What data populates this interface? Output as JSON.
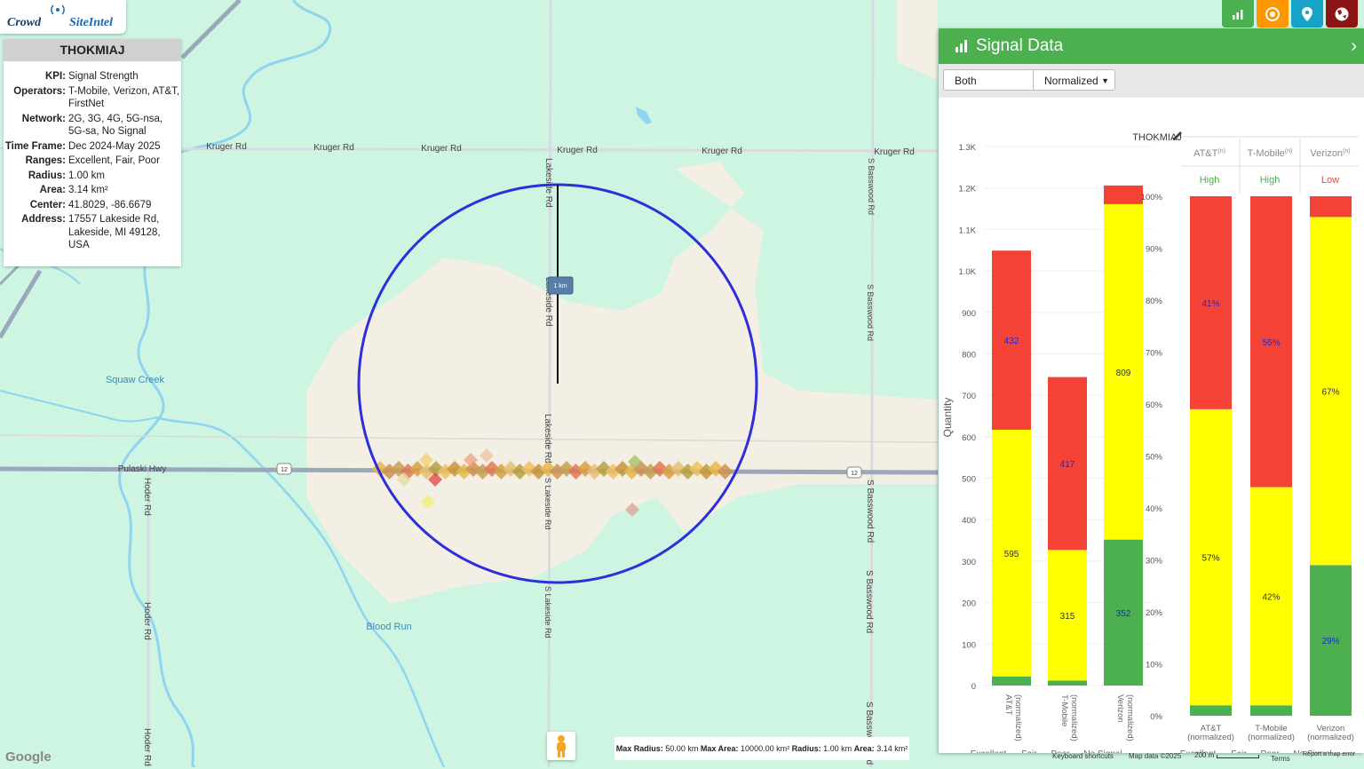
{
  "logo": {
    "part1": "Crowd",
    "part2": "SiteIntel"
  },
  "info": {
    "title": "THOKMIAJ",
    "rows": [
      {
        "k": "KPI:",
        "v": "Signal Strength"
      },
      {
        "k": "Operators:",
        "v": "T-Mobile, Verizon, AT&T, FirstNet"
      },
      {
        "k": "Network:",
        "v": "2G, 3G, 4G, 5G-nsa, 5G-sa, No Signal"
      },
      {
        "k": "Time Frame:",
        "v": "Dec 2024-May 2025"
      },
      {
        "k": "Ranges:",
        "v": "Excellent, Fair, Poor"
      },
      {
        "k": "Radius:",
        "v": "1.00 km"
      },
      {
        "k": "Area:",
        "v": "3.14 km²"
      },
      {
        "k": "Center:",
        "v": "41.8029, -86.6679"
      },
      {
        "k": "Address:",
        "v": "17557 Lakeside Rd, Lakeside, MI 49128, USA"
      }
    ]
  },
  "map": {
    "roads": {
      "kruger": "Kruger Rd",
      "lakeside": "Lakeside Rd",
      "s_lakeside": "S Lakeside Rd",
      "s_basswood": "S Basswood Rd",
      "pulaski": "Pulaski Hwy",
      "hoder": "Hoder Rd",
      "route": "12"
    },
    "water": {
      "squaw": "Squaw Creek",
      "blood": "Blood Run"
    },
    "scale_label": "1 km",
    "badge": {
      "max_radius_k": "Max Radius:",
      "max_radius_v": "50.00 km",
      "max_area_k": "Max Area:",
      "max_area_v": "10000.00 km²",
      "radius_k": "Radius:",
      "radius_v": "1.00 km",
      "area_k": "Area:",
      "area_v": "3.14 km²"
    },
    "footer": {
      "keyboard": "Keyboard shortcuts",
      "mapdata": "Map data ©2025",
      "scale": "200 m",
      "terms": "Terms",
      "report": "Report a map error"
    },
    "google": "Google"
  },
  "panel": {
    "title": "Signal Data",
    "select_mode": "Both",
    "select_norm": "Normalized",
    "chart_title": "THOKMIAJ",
    "colors": {
      "excellent": "#4caf50",
      "fair": "#ffff00",
      "poor": "#f44336",
      "nosignal": "#bdbdbd",
      "header": "#4caf50"
    },
    "legend": [
      "Excellent",
      "Fair",
      "Poor",
      "No Signal"
    ],
    "summary": [
      {
        "op": "AT&T",
        "sup": "(n)",
        "level": "High",
        "color": "#4caf50"
      },
      {
        "op": "T-Mobile",
        "sup": "(n)",
        "level": "High",
        "color": "#4caf50"
      },
      {
        "op": "Verizon",
        "sup": "(n)",
        "level": "Low",
        "color": "#f44336"
      }
    ]
  },
  "chart_data": [
    {
      "type": "bar",
      "stacked": true,
      "title": "THOKMIAJ",
      "ylabel": "Quantity",
      "ylim": [
        0,
        1300
      ],
      "yticks": [
        "0",
        "100",
        "200",
        "300",
        "400",
        "500",
        "600",
        "700",
        "800",
        "900",
        "1.0K",
        "1.1K",
        "1.2K",
        "1.3K"
      ],
      "categories": [
        "AT&T (normalized)",
        "T-Mobile (normalized)",
        "Verizon (normalized)"
      ],
      "series": [
        {
          "name": "Excellent",
          "values": [
            22,
            12,
            352
          ],
          "labels": [
            "",
            "",
            "352"
          ]
        },
        {
          "name": "Fair",
          "values": [
            595,
            315,
            809
          ],
          "labels": [
            "595",
            "315",
            "809"
          ]
        },
        {
          "name": "Poor",
          "values": [
            432,
            417,
            45
          ],
          "labels": [
            "432",
            "417",
            ""
          ]
        },
        {
          "name": "No Signal",
          "values": [
            0,
            0,
            0
          ],
          "labels": [
            "",
            "",
            ""
          ]
        }
      ]
    },
    {
      "type": "bar",
      "stacked": true,
      "ylim": [
        0,
        100
      ],
      "yticks": [
        "0%",
        "10%",
        "20%",
        "30%",
        "40%",
        "50%",
        "60%",
        "70%",
        "80%",
        "90%",
        "100%"
      ],
      "categories": [
        "AT&T (normalized)",
        "T-Mobile (normalized)",
        "Verizon (normalized)"
      ],
      "series": [
        {
          "name": "Excellent",
          "values": [
            2,
            2,
            29
          ],
          "labels": [
            "",
            "",
            "29%"
          ]
        },
        {
          "name": "Fair",
          "values": [
            57,
            42,
            67
          ],
          "labels": [
            "57%",
            "42%",
            "67%"
          ]
        },
        {
          "name": "Poor",
          "values": [
            41,
            56,
            4
          ],
          "labels": [
            "41%",
            "56%",
            ""
          ]
        },
        {
          "name": "No Signal",
          "values": [
            0,
            0,
            0
          ],
          "labels": [
            "",
            "",
            ""
          ]
        }
      ]
    }
  ]
}
